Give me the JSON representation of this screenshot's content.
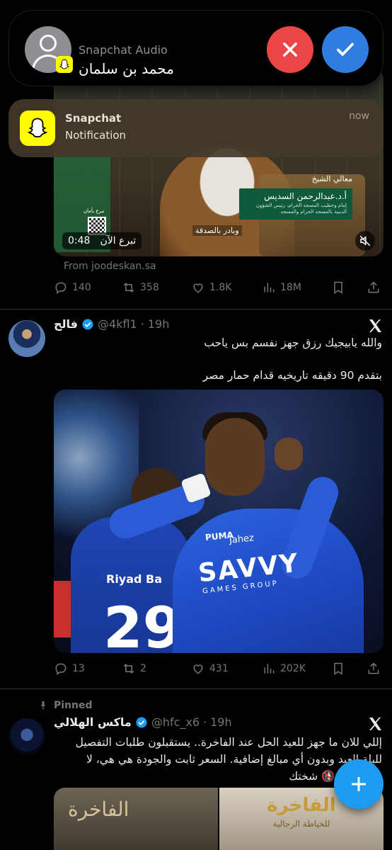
{
  "call": {
    "app": "Snapchat Audio",
    "caller": "محمد بن سلمان",
    "decline_icon": "close-icon",
    "accept_icon": "checkmark-icon"
  },
  "notification": {
    "app": "Snapchat",
    "body": "Notification",
    "time": "now"
  },
  "tweet1": {
    "media": {
      "duration": "0:48",
      "overlay_label": "تبرع الآن",
      "card_title": "معالي الشيخ",
      "card_name": "أ.د.عبدالرحمن السديس",
      "card_sub": "إمام وخطيب المسجد الحرام، رئيس الشؤون الدينية بالمسجد الحرام والمسجد",
      "caption": "وبادر بالصدقة",
      "qr_label": "تبرع بأمان"
    },
    "source": "From joodeskan.sa",
    "stats": {
      "replies": "140",
      "reposts": "358",
      "likes": "1.8K",
      "views": "18M"
    }
  },
  "tweet2": {
    "name": "فالح",
    "handle": "@4kfl1",
    "time": "19h",
    "text_line1": "والله يابيجيك رزق جهز نفسم بس ياحب",
    "text_line2": "بتقدم 90 دقيقه تاريخيه قدام حمار مصر",
    "photo": {
      "sponsor": "SAVVY",
      "sponsor_sub": "GAMES GROUP",
      "brand": "Jahez",
      "kit": "PUMA",
      "bank": "Riyad Ba",
      "number": "29"
    },
    "stats": {
      "replies": "13",
      "reposts": "2",
      "likes": "431",
      "views": "202K"
    }
  },
  "tweet3": {
    "pinned": "Pinned",
    "name": "ماكس الهلالي",
    "handle": "@hfc_x6",
    "time": "19h",
    "text_line1": "إللي للان ما جهز للعيد الحل عند الفاخرة.. يستقبلون طلبات التفصيل",
    "text_line2": "لليلة العيد وبدون أي مبالغ إضافية. السعر ثابت والجودة هي هي، لا",
    "text_line3": "تفوتك 💯 🚯 شختك",
    "photo": {
      "sign_left": "الفاخرة",
      "sign_right": "الفاخرة",
      "sign_right_sub": "للخياطة الرجالية"
    }
  },
  "fab_icon": "plus-icon",
  "colors": {
    "accent": "#1d9bf0",
    "decline": "#eb4545",
    "accept": "#2f7de1",
    "snap": "#fffc00",
    "muted": "#71767b"
  }
}
